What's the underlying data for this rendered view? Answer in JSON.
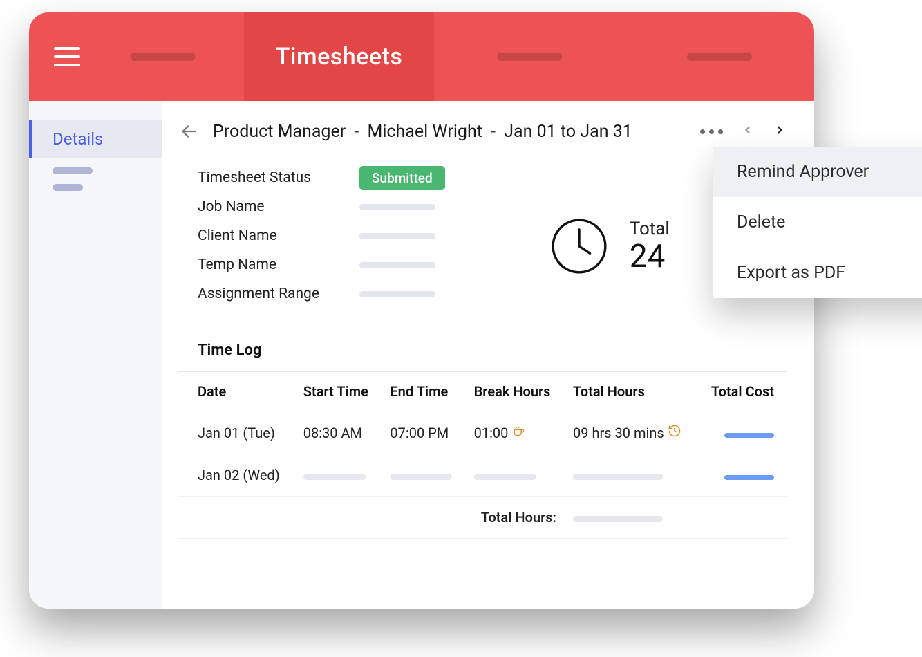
{
  "header": {
    "title": "Timesheets"
  },
  "sidebar": {
    "activeTab": "Details"
  },
  "topbar": {
    "crumb_role": "Product Manager",
    "crumb_person": "Michael Wright",
    "crumb_range": "Jan 01 to Jan 31"
  },
  "fields": {
    "status_label": "Timesheet Status",
    "status_value": "Submitted",
    "job_label": "Job Name",
    "client_label": "Client Name",
    "temp_label": "Temp Name",
    "range_label": "Assignment Range"
  },
  "summary": {
    "total_label": "Total",
    "total_value": "24"
  },
  "timelog": {
    "section": "Time Log",
    "columns": {
      "date": "Date",
      "start": "Start Time",
      "end": "End Time",
      "break": "Break Hours",
      "total": "Total Hours",
      "cost": "Total Cost"
    },
    "rows": {
      "0": {
        "date": "Jan 01 (Tue)",
        "start": "08:30 AM",
        "end": "07:00 PM",
        "break": "01:00",
        "total": "09 hrs 30 mins"
      },
      "1": {
        "date": "Jan 02 (Wed)"
      }
    },
    "footer_label": "Total Hours:"
  },
  "menu": {
    "remind": "Remind Approver",
    "delete": "Delete",
    "export": "Export as PDF"
  }
}
